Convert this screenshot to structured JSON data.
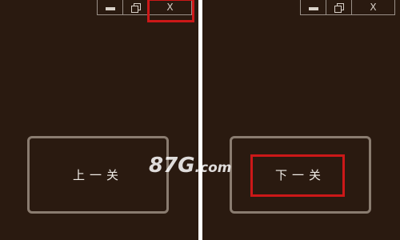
{
  "left_window": {
    "close_label": "X",
    "level_button_label": "上一关"
  },
  "right_window": {
    "close_label": "X",
    "level_button_label": "下一关"
  },
  "watermark": {
    "main": "87G",
    "suffix": ".com"
  },
  "colors": {
    "window_bg": "#2a1a10",
    "highlight_red": "#cc1818",
    "button_border": "#8a7c70"
  }
}
